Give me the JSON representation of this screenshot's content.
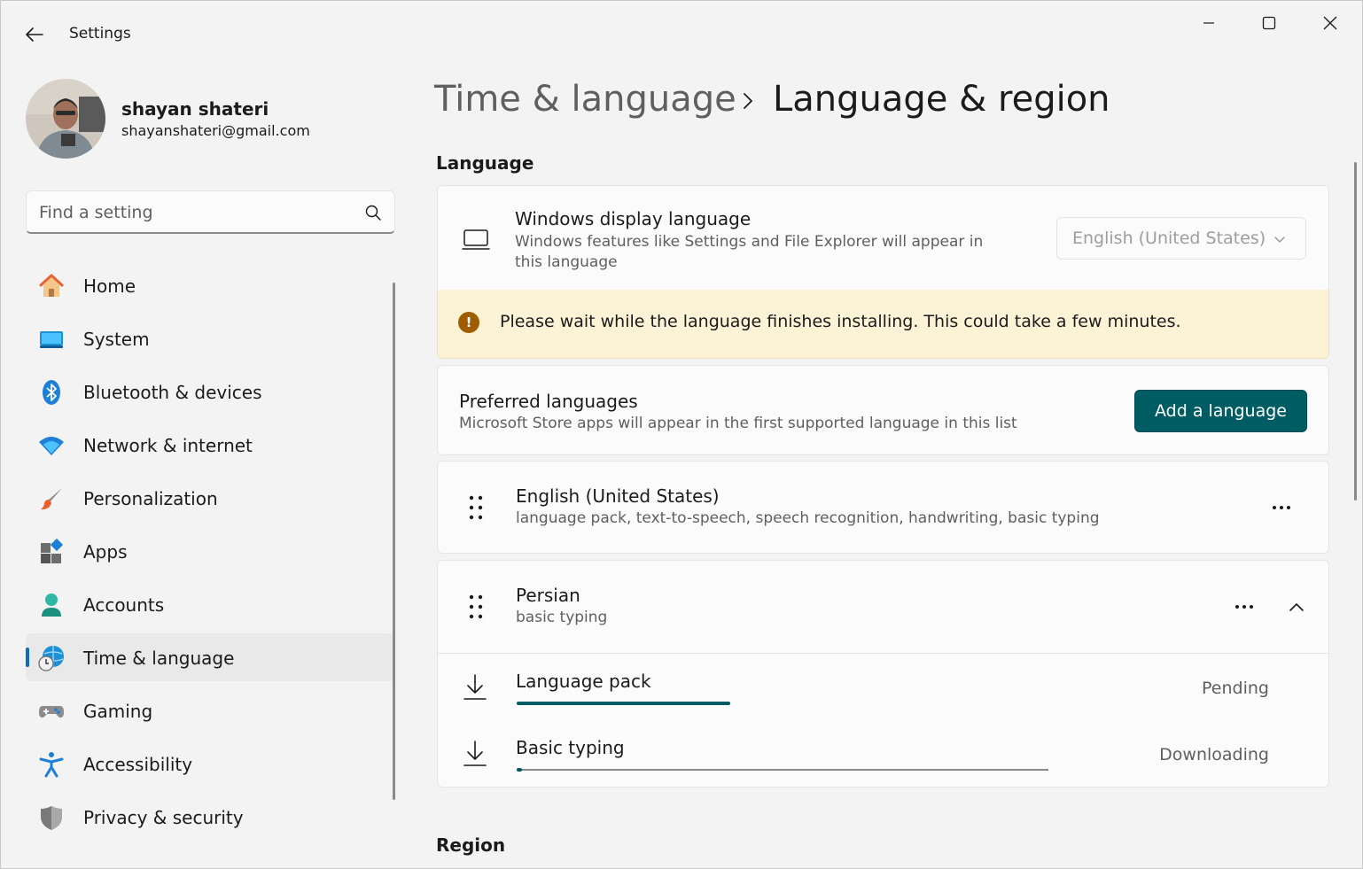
{
  "window": {
    "title": "Settings"
  },
  "profile": {
    "name": "shayan shateri",
    "email": "shayanshateri@gmail.com"
  },
  "search": {
    "placeholder": "Find a setting",
    "value": ""
  },
  "nav": {
    "items": [
      {
        "label": "Home",
        "icon": "home-icon"
      },
      {
        "label": "System",
        "icon": "system-icon"
      },
      {
        "label": "Bluetooth & devices",
        "icon": "bluetooth-icon"
      },
      {
        "label": "Network & internet",
        "icon": "wifi-icon"
      },
      {
        "label": "Personalization",
        "icon": "brush-icon"
      },
      {
        "label": "Apps",
        "icon": "apps-icon"
      },
      {
        "label": "Accounts",
        "icon": "accounts-icon"
      },
      {
        "label": "Time & language",
        "icon": "time-language-icon",
        "active": true
      },
      {
        "label": "Gaming",
        "icon": "gamepad-icon"
      },
      {
        "label": "Accessibility",
        "icon": "accessibility-icon"
      },
      {
        "label": "Privacy & security",
        "icon": "shield-icon"
      }
    ]
  },
  "breadcrumb": {
    "parent": "Time & language",
    "current": "Language & region"
  },
  "language": {
    "section_title": "Language",
    "display": {
      "title": "Windows display language",
      "description": "Windows features like Settings and File Explorer will appear in this language",
      "selected": "English (United States)"
    },
    "warning": "Please wait while the language finishes installing. This could take a few minutes.",
    "preferred": {
      "title": "Preferred languages",
      "description": "Microsoft Store apps will appear in the first supported language in this list",
      "add_button": "Add a language"
    },
    "languages": [
      {
        "name": "English (United States)",
        "features": "language pack, text-to-speech, speech recognition, handwriting, basic typing"
      },
      {
        "name": "Persian",
        "features": "basic typing"
      }
    ],
    "downloads": [
      {
        "label": "Language pack",
        "status": "Pending",
        "progress": 0.41
      },
      {
        "label": "Basic typing",
        "status": "Downloading",
        "progress": 0.01
      }
    ]
  },
  "region": {
    "section_title": "Region"
  },
  "colors": {
    "accent": "#005c63",
    "warning_bg": "#fcf3d6",
    "warning_icon": "#9d5d00",
    "nav_indicator": "#0f6cbd"
  }
}
